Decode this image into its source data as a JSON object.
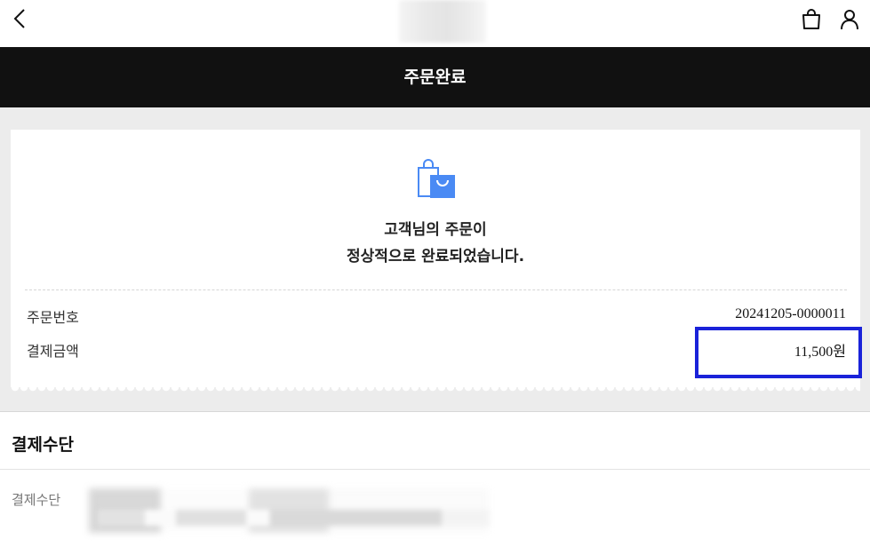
{
  "header": {
    "back_icon": "chevron-left-icon",
    "cart_icon": "shopping-bag-icon",
    "user_icon": "user-icon"
  },
  "titlebar": {
    "title": "주문완료"
  },
  "completion": {
    "icon": "shopping-bags-icon",
    "message_line1": "고객님의 주문이",
    "message_line2": "정상적으로 완료되었습니다."
  },
  "order_info": {
    "order_number_label": "주문번호",
    "order_number_value": "20241205-0000011",
    "amount_label": "결제금액",
    "amount_value": "11,500원"
  },
  "payment_section": {
    "title": "결제수단",
    "method_label": "결제수단"
  },
  "colors": {
    "titlebar_bg": "#111111",
    "highlight": "#1a22d9",
    "icon_blue": "#4a8af4",
    "page_gray": "#ececec"
  }
}
